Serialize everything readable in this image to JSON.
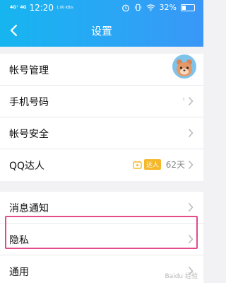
{
  "status_bar": {
    "network": "4G⁺ 4G",
    "time": "12:20",
    "speed": "1.00 KB/s",
    "battery_percent": "32%",
    "battery_level": 0.32
  },
  "header": {
    "title": "设置"
  },
  "settings": {
    "account_manage": "帐号管理",
    "phone_number": "手机号码",
    "phone_hint": "›",
    "account_security": "帐号安全",
    "qq_expert": "QQ达人",
    "qq_expert_badge": "达人",
    "qq_expert_days": "62天",
    "message_notify": "消息通知",
    "privacy": "隐私",
    "general": "通用"
  },
  "watermark": "Baidu 经验"
}
